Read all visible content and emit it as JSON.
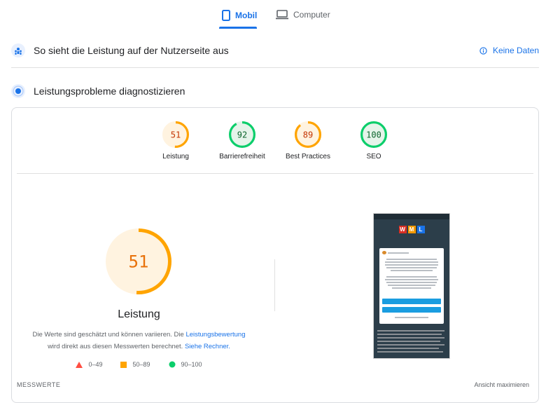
{
  "tabs": [
    {
      "label": "Mobil",
      "icon": "smartphone-icon",
      "selected": true
    },
    {
      "label": "Computer",
      "icon": "laptop-icon",
      "selected": false
    }
  ],
  "field_section": {
    "title": "So sieht die Leistung auf der Nutzerseite aus",
    "no_data": "Keine Daten"
  },
  "diagnose_section": {
    "title": "Leistungsprobleme diagnostizieren"
  },
  "scores": [
    {
      "value": 51,
      "label": "Leistung",
      "color": "#ffa400",
      "bg": "#fff3e0",
      "text": "#c33300"
    },
    {
      "value": 92,
      "label": "Barrierefreiheit",
      "color": "#0cce6b",
      "bg": "#e6f4ea",
      "text": "#0d652d"
    },
    {
      "value": 89,
      "label": "Best Practices",
      "color": "#ffa400",
      "bg": "#fff3e0",
      "text": "#c33300"
    },
    {
      "value": 100,
      "label": "SEO",
      "color": "#0cce6b",
      "bg": "#e6f4ea",
      "text": "#0d652d"
    }
  ],
  "performance": {
    "score": 51,
    "title": "Leistung",
    "desc_part1": "Die Werte sind geschätzt und können variieren. Die ",
    "desc_link1": "Leistungsbewertung",
    "desc_part2": " wird direkt aus diesen Messwerten berechnet. ",
    "desc_link2": "Siehe Rechner."
  },
  "legend": [
    {
      "range": "0–49",
      "shape": "triangle",
      "color": "#ff4e42"
    },
    {
      "range": "50–89",
      "shape": "square",
      "color": "#ffa400"
    },
    {
      "range": "90–100",
      "shape": "circle",
      "color": "#0cce6b"
    }
  ],
  "footer": {
    "metrics_label": "MESSWERTE",
    "expand_view": "Ansicht maximieren"
  },
  "brand_letters": [
    "W",
    "M",
    "L"
  ],
  "colors": {
    "accent": "#1a73e8",
    "average": "#ffa400",
    "pass": "#0cce6b",
    "fail": "#ff4e42"
  }
}
